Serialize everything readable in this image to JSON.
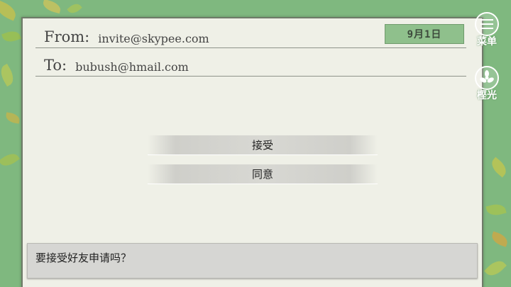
{
  "email": {
    "from_label": "From:",
    "from_value": "invite@skypee.com",
    "to_label": "To:",
    "to_value": "bubush@hmail.com",
    "date": "9月1日"
  },
  "choices": [
    {
      "label": "接受"
    },
    {
      "label": "同意"
    }
  ],
  "message": "要接受好友申请吗？",
  "side_menu": {
    "menu_label": "菜单",
    "menu_icon": "hamburger-icon",
    "skip_label": "樫光",
    "skip_icon": "fan-icon"
  },
  "colors": {
    "background": "#7fb87f",
    "panel": "#eff0e7",
    "date_badge": "#8fc08c"
  }
}
